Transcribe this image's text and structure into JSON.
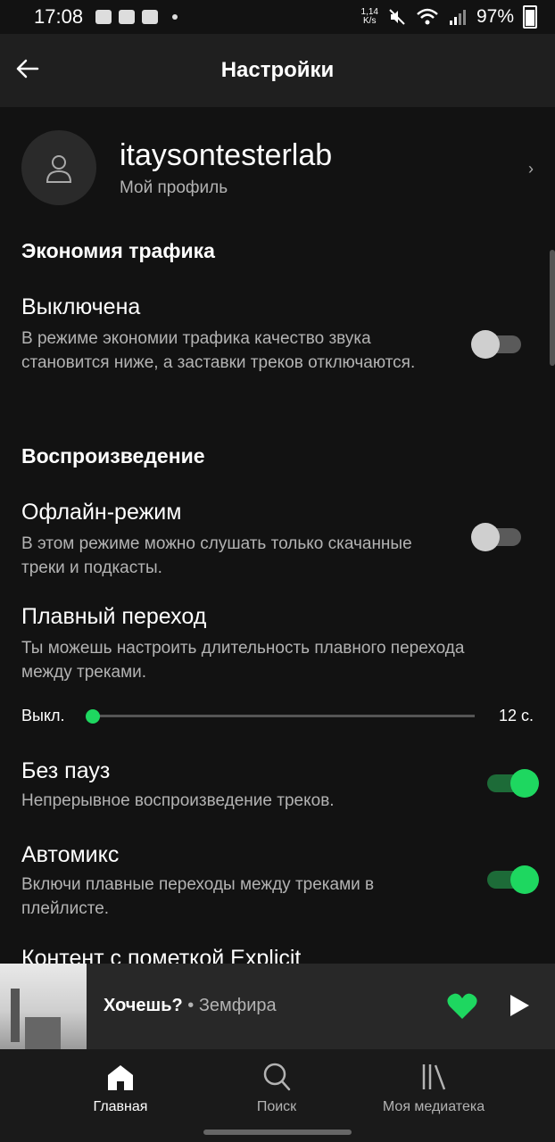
{
  "status_bar": {
    "time": "17:08",
    "speed": "1,14\nK/s",
    "battery": "97%"
  },
  "app_bar": {
    "title": "Настройки"
  },
  "profile": {
    "name": "itaysontesterlab",
    "subtitle": "Мой профиль"
  },
  "sections": {
    "data_saver": "Экономия трафика",
    "playback": "Воспроизведение"
  },
  "settings": {
    "data_saver": {
      "title": "Выключена",
      "description": "В режиме экономии трафика качество звука становится ниже, а заставки треков отключаются.",
      "enabled": false
    },
    "offline": {
      "title": "Офлайн-режим",
      "description": "В этом режиме можно слушать только скачанные треки и подкасты.",
      "enabled": false
    },
    "crossfade": {
      "title": "Плавный переход",
      "description": "Ты можешь настроить длительность плавного перехода между треками.",
      "min_label": "Выкл.",
      "max_label": "12 с.",
      "value": 0
    },
    "gapless": {
      "title": "Без пауз",
      "description": "Непрерывное воспроизведение треков.",
      "enabled": true
    },
    "automix": {
      "title": "Автомикс",
      "description": "Включи плавные переходы между треками в плейлисте.",
      "enabled": true
    },
    "explicit": {
      "title": "Контент с пометкой Explicit"
    }
  },
  "player": {
    "track": "Хочешь?",
    "separator": " • ",
    "artist": "Земфира",
    "liked": true
  },
  "nav": [
    {
      "label": "Главная",
      "icon": "home-icon",
      "active": true
    },
    {
      "label": "Поиск",
      "icon": "search-icon",
      "active": false
    },
    {
      "label": "Моя медиатека",
      "icon": "library-icon",
      "active": false
    }
  ],
  "colors": {
    "accent": "#1ed760",
    "background": "#121212",
    "appbar": "#1f1f1f"
  }
}
